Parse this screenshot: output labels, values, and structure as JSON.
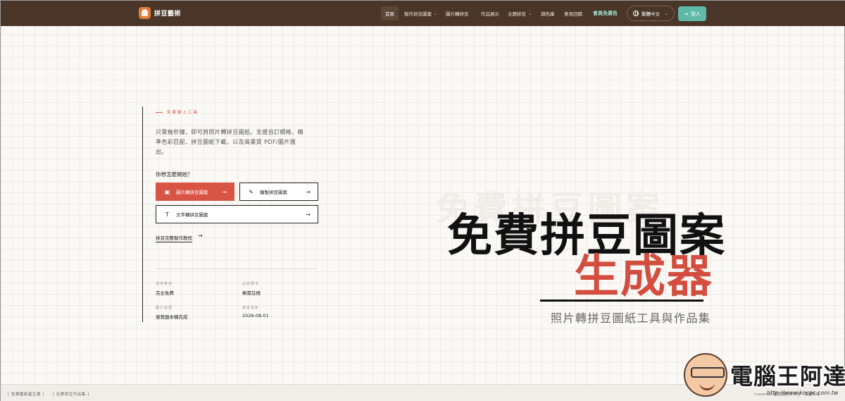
{
  "app": {
    "logo_text": "拼豆藝術"
  },
  "nav": {
    "home": "首頁",
    "make_pattern": "製作拼豆圖案",
    "photo_to_pattern": "圖片轉拼豆",
    "gallery": "作品展示",
    "themes": "主題拼豆",
    "palette": "調色庫",
    "feedback": "意見回饋",
    "vip": "會員免廣告",
    "language": "繁體中文",
    "login": "登入"
  },
  "hero": {
    "kicker": "免費線上工具",
    "description": "只需幾秒鐘，即可將照片轉拼豆圖紙。支援自訂網格、精準色彩匹配、拼豆圖紙下載，以及高畫質 PDF/圖片匯出。",
    "question": "你想怎麼開始？",
    "btn_photo": "圖片轉拼豆圖案",
    "btn_draw": "繪製拼豆圖案",
    "btn_text": "文字轉拼豆圖案",
    "tutorial": "拼豆完整製作教程",
    "ghost_title": "免費拼豆圖案",
    "title_line1": "免費拼豆圖案",
    "title_line2": "生成器",
    "subtitle": "照片轉拼豆圖紙工具與作品集"
  },
  "stats": [
    {
      "label": "使用費用",
      "value": "完全免費"
    },
    {
      "label": "註冊要求",
      "value": "無需註冊"
    },
    {
      "label": "圖片處理",
      "value": "瀏覽器本機完成"
    },
    {
      "label": "最後更新",
      "value": "2026-08-01"
    }
  ],
  "footer": {
    "link1": "[ 免費圖紙產生器 ]",
    "link2": "[ 社群拼豆作品集 ]",
    "right": "ncesmart 國豆圖紙工作室 · 版權所有"
  },
  "watermark": {
    "text": "電腦王阿達",
    "url": "http://www.kocpc.com.tw"
  },
  "colors": {
    "header": "#4a3628",
    "accent": "#d85546",
    "login": "#5fb9a8"
  },
  "icons": {
    "photo": "image-icon",
    "draw": "pencil-icon",
    "text": "text-icon",
    "arrow": "arrow-right-icon",
    "globe": "globe-icon",
    "login": "login-icon"
  }
}
